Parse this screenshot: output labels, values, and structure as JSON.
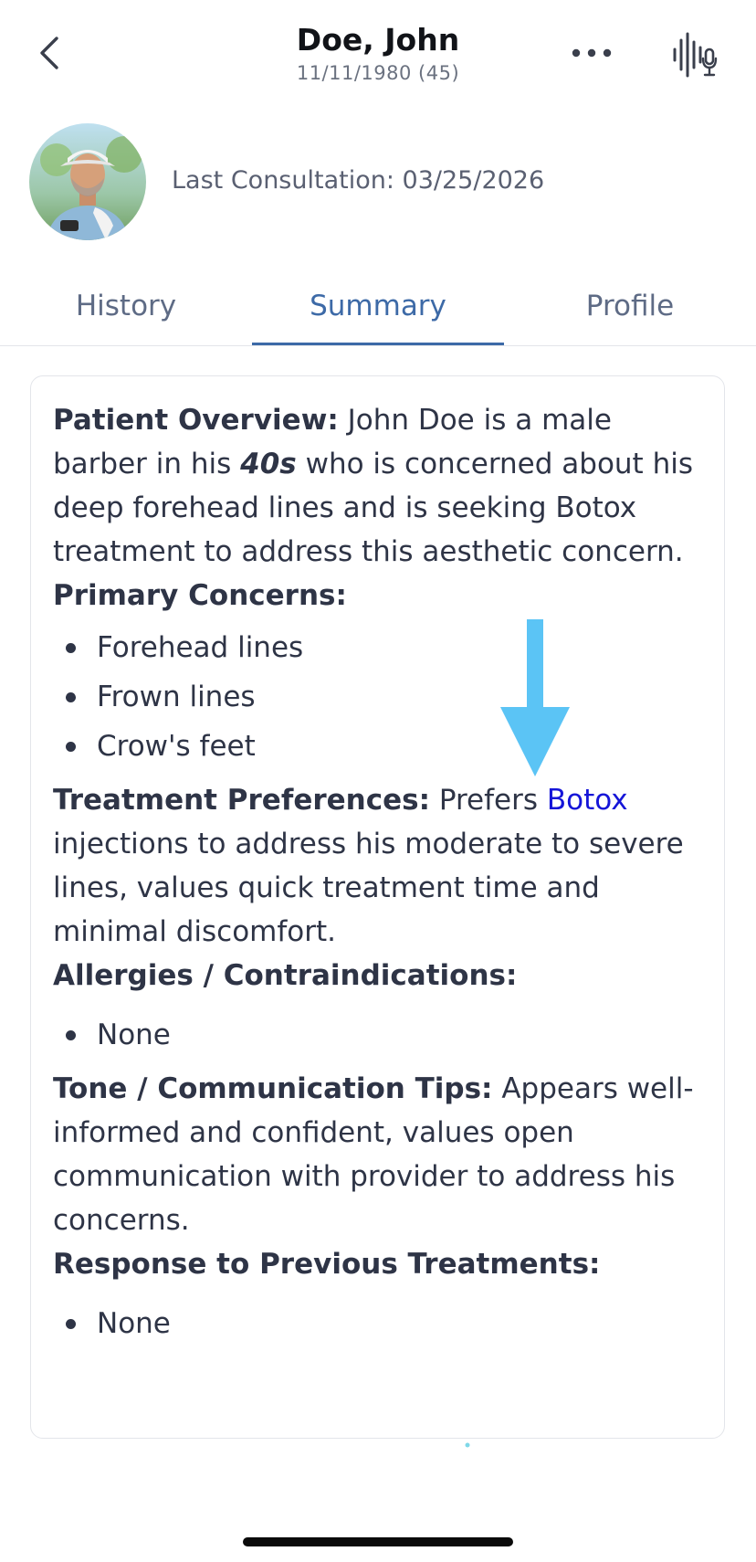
{
  "header": {
    "name": "Doe, John",
    "dob_age": "11/11/1980 (45)",
    "back_icon": "chevron-left-icon",
    "more_icon": "ellipsis-icon",
    "voice_icon": "voice-waveform-mic-icon"
  },
  "profile": {
    "last_consultation_label": "Last Consultation:",
    "last_consultation_date": "03/25/2026"
  },
  "tabs": [
    {
      "label": "History",
      "active": false
    },
    {
      "label": "Summary",
      "active": true
    },
    {
      "label": "Profile",
      "active": false
    }
  ],
  "summary": {
    "overview": {
      "label": "Patient Overview:",
      "text_1": " John Doe is a male barber in his ",
      "emphasis": "40s",
      "text_2": " who is concerned about his deep forehead lines and is seeking Botox treatment to address this aesthetic concern."
    },
    "primary_concerns": {
      "label": "Primary Concerns:",
      "items": [
        "Forehead lines",
        "Frown lines",
        "Crow's feet"
      ]
    },
    "treatment_preferences": {
      "label": "Treatment Preferences:",
      "text_1": " Prefers ",
      "link": "Botox",
      "text_2": " injections to address his moderate to severe lines, values quick treatment time and minimal discomfort."
    },
    "allergies": {
      "label": "Allergies / Contraindications:",
      "items": [
        "None"
      ]
    },
    "tone": {
      "label": "Tone / Communication Tips:",
      "text": " Appears well-informed and confident, values open communication with provider to address his concerns."
    },
    "previous_treatments": {
      "label": "Response to Previous Treatments:",
      "items": [
        "None"
      ]
    }
  },
  "colors": {
    "accent": "#3d6aa7",
    "link": "#1515d8",
    "annotation_arrow": "#5bc4f5"
  }
}
